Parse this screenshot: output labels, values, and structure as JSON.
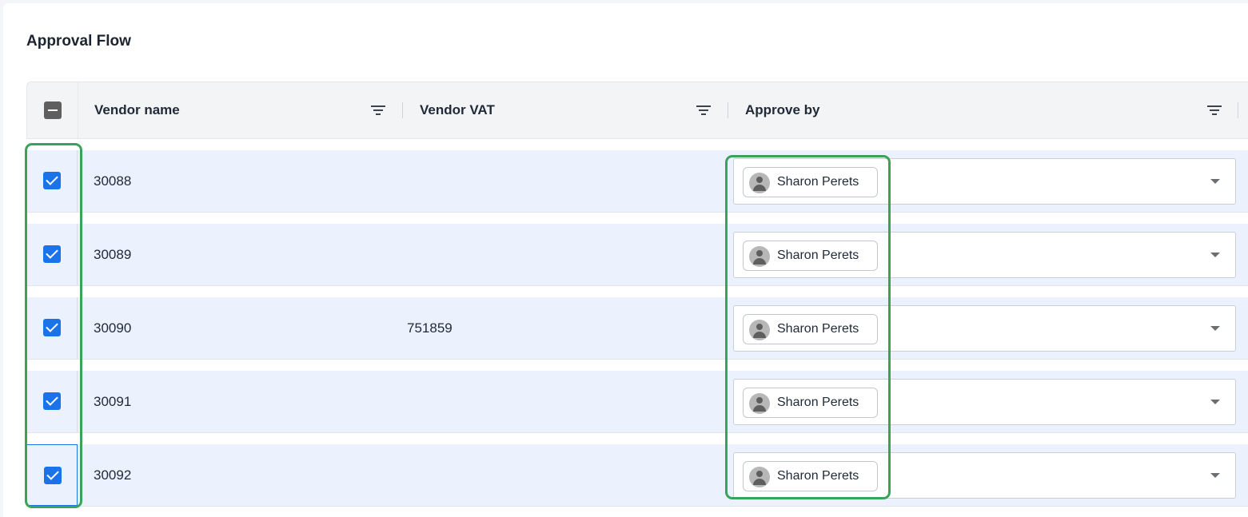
{
  "page": {
    "title": "Approval Flow"
  },
  "table": {
    "columns": [
      {
        "label": "Vendor name"
      },
      {
        "label": "Vendor VAT"
      },
      {
        "label": "Approve by"
      }
    ],
    "rows": [
      {
        "vendor_name": "30088",
        "vendor_vat": "",
        "approver": "Sharon Perets",
        "checked": true
      },
      {
        "vendor_name": "30089",
        "vendor_vat": "",
        "approver": "Sharon Perets",
        "checked": true
      },
      {
        "vendor_name": "30090",
        "vendor_vat": "751859",
        "approver": "Sharon Perets",
        "checked": true
      },
      {
        "vendor_name": "30091",
        "vendor_vat": "",
        "approver": "Sharon Perets",
        "checked": true
      },
      {
        "vendor_name": "30092",
        "vendor_vat": "",
        "approver": "Sharon Perets",
        "checked": true
      }
    ]
  },
  "colors": {
    "accent": "#1a73e8",
    "row_bg": "#ebf2fd",
    "highlight": "#3aa35a"
  }
}
